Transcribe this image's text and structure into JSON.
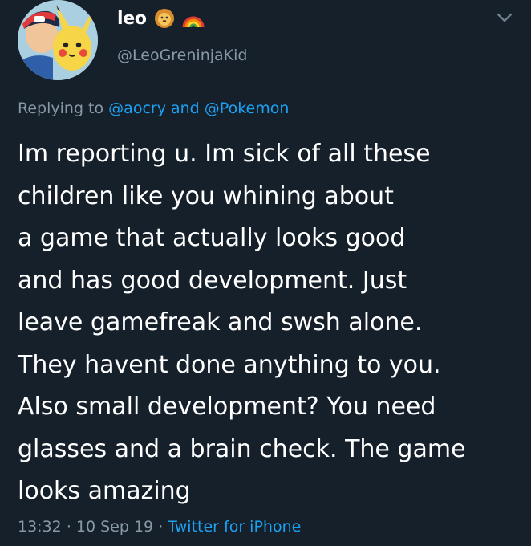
{
  "author": {
    "display_name": "leo",
    "handle": "@LeoGreninjaKid",
    "name_emojis": [
      "lion-face-emoji",
      "rainbow-emoji"
    ]
  },
  "reply_context": {
    "prefix": "Replying to",
    "mention1": "@aocry",
    "conjunction": "and",
    "mention2": "@Pokemon"
  },
  "tweet_lines": [
    "Im reporting u. Im sick of all these",
    "children like you whining about",
    "a game that actually looks good",
    "and has good development. Just",
    "leave gamefreak and swsh alone.",
    "They havent done anything to you.",
    "Also small development? You need",
    "glasses and a brain check. The game",
    "looks amazing"
  ],
  "meta": {
    "time": "13:32",
    "separator": "·",
    "date": "10 Sep 19",
    "source": "Twitter for iPhone"
  },
  "colors": {
    "background": "#15202b",
    "text": "#ffffff",
    "secondary": "#8899a6",
    "link": "#1da1f2"
  }
}
